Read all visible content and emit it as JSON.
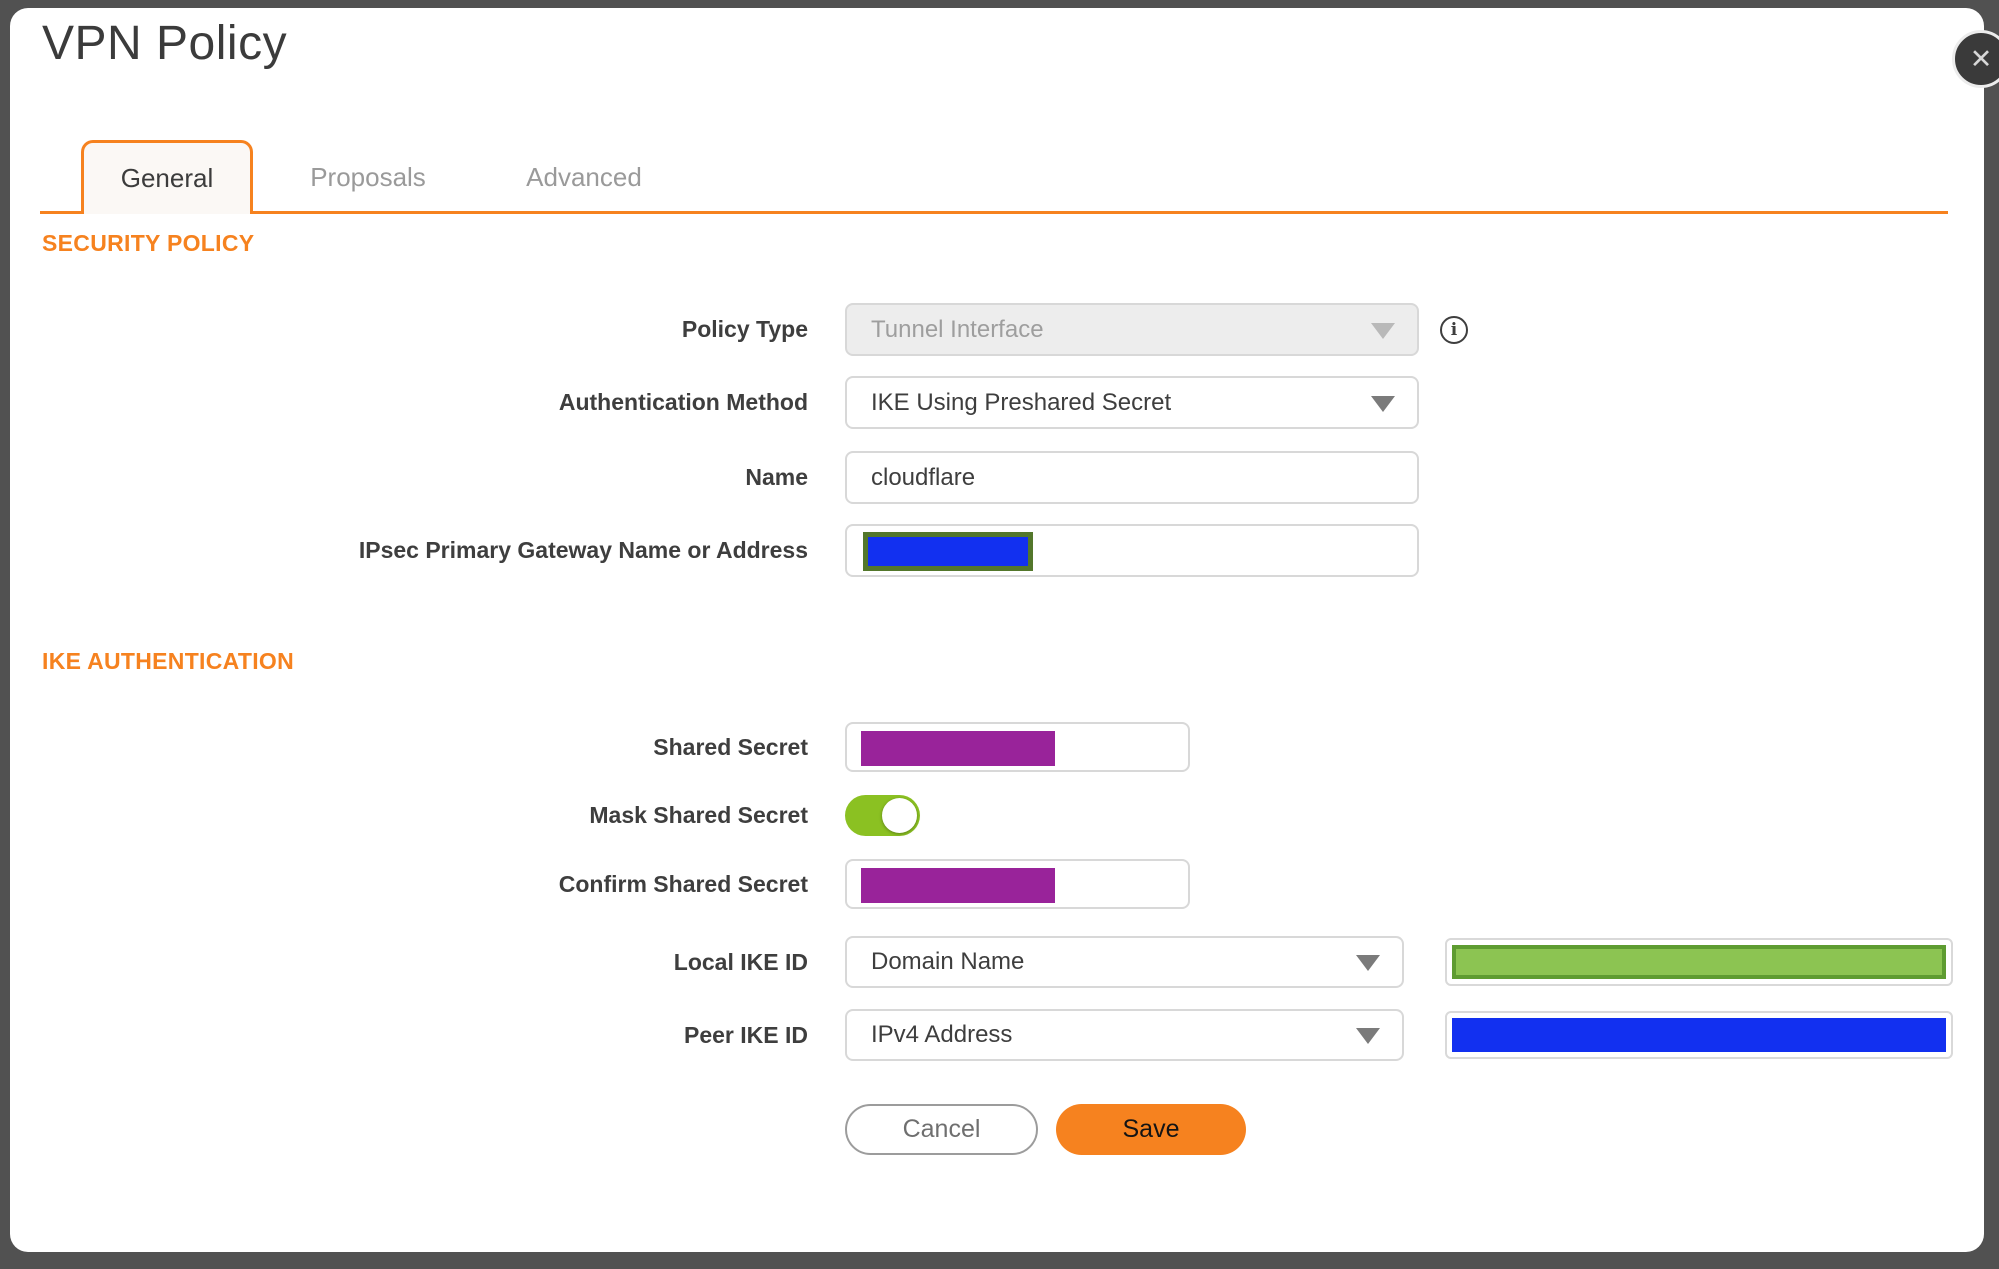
{
  "dialog": {
    "title": "VPN Policy"
  },
  "tabs": [
    {
      "label": "General",
      "active": true
    },
    {
      "label": "Proposals",
      "active": false
    },
    {
      "label": "Advanced",
      "active": false
    }
  ],
  "sections": {
    "security_policy": "SECURITY POLICY",
    "ike_authentication": "IKE AUTHENTICATION"
  },
  "fields": {
    "policy_type": {
      "label": "Policy Type",
      "value": "Tunnel Interface",
      "disabled": true
    },
    "auth_method": {
      "label": "Authentication Method",
      "value": "IKE Using Preshared Secret"
    },
    "name": {
      "label": "Name",
      "value": "cloudflare"
    },
    "gateway": {
      "label": "IPsec Primary Gateway Name or Address",
      "value": "",
      "redacted": true
    },
    "shared_secret": {
      "label": "Shared Secret",
      "redacted": true
    },
    "mask_shared_secret": {
      "label": "Mask Shared Secret",
      "state": "on"
    },
    "confirm_shared_secret": {
      "label": "Confirm Shared Secret",
      "redacted": true
    },
    "local_ike_id": {
      "label": "Local IKE ID",
      "value": "Domain Name",
      "id_value_redacted": true
    },
    "peer_ike_id": {
      "label": "Peer IKE ID",
      "value": "IPv4 Address",
      "id_value_redacted": true
    }
  },
  "buttons": {
    "cancel": "Cancel",
    "save": "Save"
  },
  "icons": {
    "close": "✕",
    "info": "i"
  },
  "colors": {
    "accent_orange": "#F6821F",
    "toggle_green": "#8BC122",
    "redact_purple": "#99239A",
    "redact_blue": "#1230F0",
    "olive_border": "#53772B",
    "green_fill": "#8CC452",
    "green_border": "#5E9C31",
    "bg_dark": "#515151",
    "close_bg": "#3A3A3A"
  }
}
